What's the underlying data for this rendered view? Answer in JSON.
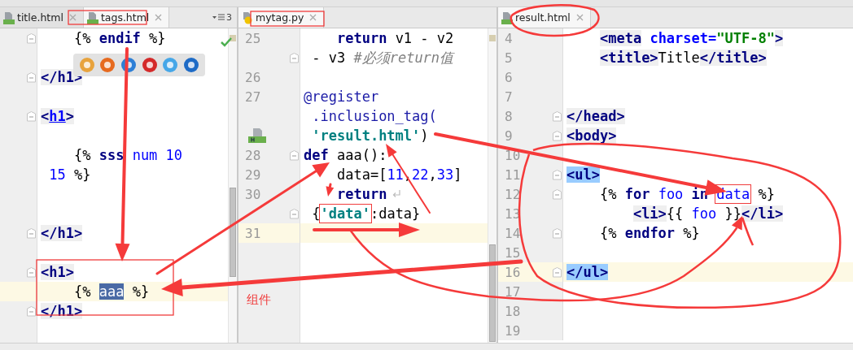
{
  "panes": [
    {
      "tabs": [
        {
          "label": "title.html",
          "selected": false
        },
        {
          "label": "tags.html",
          "selected": true
        }
      ],
      "tab_overflow": "3",
      "scrollbar": true,
      "lines": [
        {
          "fold": true,
          "current": false,
          "tokens": [
            {
              "kind": "plain",
              "text": "    {% "
            },
            {
              "kind": "kw",
              "text": "endif"
            },
            {
              "kind": "plain",
              "text": " %}"
            }
          ]
        },
        {
          "fold": false,
          "current": false
        },
        {
          "fold": true,
          "current": false,
          "tokens": [
            {
              "kind": "tag",
              "text": "</h1>"
            }
          ]
        },
        {
          "fold": false,
          "current": false
        },
        {
          "fold": true,
          "current": false,
          "tokens": [
            {
              "kind": "tag",
              "text": "<"
            },
            {
              "kind": "link",
              "text": "h1"
            },
            {
              "kind": "tag",
              "text": ">"
            }
          ]
        },
        {
          "fold": false,
          "current": false
        },
        {
          "fold": false,
          "current": false,
          "tokens": [
            {
              "kind": "plain",
              "text": "    {% "
            },
            {
              "kind": "kw",
              "text": "sss"
            },
            {
              "kind": "var",
              "text": " num 10"
            }
          ]
        },
        {
          "fold": false,
          "current": false,
          "tokens": [
            {
              "kind": "var",
              "text": " 15"
            },
            {
              "kind": "plain",
              "text": " %}"
            }
          ]
        },
        {
          "fold": false,
          "current": false
        },
        {
          "fold": false,
          "current": false
        },
        {
          "fold": true,
          "current": false,
          "tokens": [
            {
              "kind": "tag",
              "text": "</h1>"
            }
          ]
        },
        {
          "fold": false,
          "current": false
        },
        {
          "fold": true,
          "current": false,
          "tokens": [
            {
              "kind": "tag",
              "text": "<h1>"
            }
          ]
        },
        {
          "fold": false,
          "current": true,
          "tokens": [
            {
              "kind": "plain",
              "text": "    {% "
            },
            {
              "kind": "sel",
              "text": "aaa"
            },
            {
              "kind": "plain",
              "text": " %}"
            }
          ]
        },
        {
          "fold": true,
          "current": false,
          "tokens": [
            {
              "kind": "tag",
              "text": "</h1>"
            }
          ]
        },
        {
          "fold": false,
          "current": false
        },
        {
          "fold": false,
          "current": false
        }
      ]
    },
    {
      "tabs": [
        {
          "label": "mytag.py",
          "selected": true
        }
      ],
      "scrollbar": true,
      "lines": [
        {
          "number": "25",
          "fold": false,
          "current": false,
          "tokens": [
            {
              "kind": "kw",
              "text": "    return"
            },
            {
              "kind": "plain",
              "text": " v1 - v2"
            }
          ]
        },
        {
          "fold": true,
          "current": false,
          "tokens": [
            {
              "kind": "plain",
              "text": " - v3 "
            },
            {
              "kind": "comment",
              "text": "#必须return值"
            }
          ]
        },
        {
          "number": "26",
          "fold": false,
          "current": false
        },
        {
          "number": "27",
          "fold": false,
          "current": false,
          "tokens": [
            {
              "kind": "deco",
              "text": "@register"
            }
          ]
        },
        {
          "fold": false,
          "current": false,
          "tokens": [
            {
              "kind": "deco",
              "text": " .inclusion_tag("
            }
          ]
        },
        {
          "gutter_icon": true,
          "fold": false,
          "current": false,
          "tokens": [
            {
              "kind": "pystr",
              "text": " 'result.html'"
            },
            {
              "kind": "plain",
              "text": ")"
            }
          ]
        },
        {
          "number": "28",
          "fold": true,
          "current": false,
          "tokens": [
            {
              "kind": "kw",
              "text": "def"
            },
            {
              "kind": "plain",
              "text": " aaa():"
            }
          ]
        },
        {
          "number": "29",
          "fold": false,
          "current": false,
          "tokens": [
            {
              "kind": "plain",
              "text": "    data=["
            },
            {
              "kind": "var",
              "text": "11"
            },
            {
              "kind": "plain",
              "text": ","
            },
            {
              "kind": "var",
              "text": "22"
            },
            {
              "kind": "plain",
              "text": ","
            },
            {
              "kind": "var",
              "text": "33"
            },
            {
              "kind": "plain",
              "text": "]"
            }
          ]
        },
        {
          "number": "30",
          "wrap_mark": true,
          "fold": false,
          "current": false,
          "tokens": [
            {
              "kind": "kw",
              "text": "    return"
            }
          ]
        },
        {
          "fold": true,
          "current": false,
          "tokens": [
            {
              "kind": "plain",
              "text": " {"
            },
            {
              "kind": "pystr",
              "text": "'data'"
            },
            {
              "kind": "plain",
              "text": ":data}"
            }
          ]
        },
        {
          "number": "31",
          "fold": false,
          "current": true
        },
        {
          "fold": false,
          "current": false
        },
        {
          "fold": false,
          "current": false
        },
        {
          "fold": false,
          "current": false
        },
        {
          "fold": false,
          "current": false
        },
        {
          "fold": false,
          "current": false
        },
        {
          "fold": false,
          "current": false
        }
      ]
    },
    {
      "tabs": [
        {
          "label": "result.html",
          "selected": true
        }
      ],
      "lines": [
        {
          "number": "4",
          "fold": false,
          "current": false,
          "tokens": [
            {
              "kind": "tag",
              "text": "    <meta"
            },
            {
              "kind": "attr",
              "text": " charset="
            },
            {
              "kind": "str",
              "text": "\"UTF-8\""
            },
            {
              "kind": "tag",
              "text": ">"
            }
          ]
        },
        {
          "number": "5",
          "fold": false,
          "current": false,
          "tokens": [
            {
              "kind": "tag",
              "text": "    <title>"
            },
            {
              "kind": "plain",
              "text": "Title"
            },
            {
              "kind": "tag",
              "text": "</title>"
            }
          ]
        },
        {
          "number": "6",
          "fold": false,
          "current": false
        },
        {
          "number": "7",
          "fold": false,
          "current": false
        },
        {
          "number": "8",
          "fold": true,
          "current": false,
          "tokens": [
            {
              "kind": "tag",
              "text": "</head>"
            }
          ]
        },
        {
          "number": "9",
          "fold": true,
          "current": false,
          "tokens": [
            {
              "kind": "tag",
              "text": "<body>"
            }
          ]
        },
        {
          "number": "10",
          "fold": false,
          "current": false
        },
        {
          "number": "11",
          "fold": true,
          "current": false,
          "tokens": [
            {
              "kind": "match",
              "text": "<ul>"
            }
          ]
        },
        {
          "number": "12",
          "fold": true,
          "current": false,
          "tokens": [
            {
              "kind": "plain",
              "text": "    {% "
            },
            {
              "kind": "kw",
              "text": "for"
            },
            {
              "kind": "var",
              "text": " foo"
            },
            {
              "kind": "kw",
              "text": " in"
            },
            {
              "kind": "var",
              "text": " data"
            },
            {
              "kind": "plain",
              "text": " %}"
            }
          ]
        },
        {
          "number": "13",
          "fold": false,
          "current": false,
          "tokens": [
            {
              "kind": "tag",
              "text": "        <li>"
            },
            {
              "kind": "plain",
              "text": "{{ "
            },
            {
              "kind": "var",
              "text": "foo"
            },
            {
              "kind": "plain",
              "text": " }}"
            },
            {
              "kind": "tag",
              "text": "</li>"
            }
          ]
        },
        {
          "number": "14",
          "fold": true,
          "current": false,
          "tokens": [
            {
              "kind": "plain",
              "text": "    {% "
            },
            {
              "kind": "kw",
              "text": "endfor"
            },
            {
              "kind": "plain",
              "text": " %}"
            }
          ]
        },
        {
          "number": "15",
          "fold": false,
          "current": false
        },
        {
          "number": "16",
          "fold": true,
          "current": true,
          "tokens": [
            {
              "kind": "match",
              "text": "</ul>"
            }
          ]
        },
        {
          "number": "17",
          "fold": false,
          "current": false
        },
        {
          "number": "18",
          "fold": false,
          "current": false
        },
        {
          "number": "19",
          "fold": false,
          "current": false
        }
      ]
    }
  ],
  "annotation": {
    "text": "组件"
  }
}
